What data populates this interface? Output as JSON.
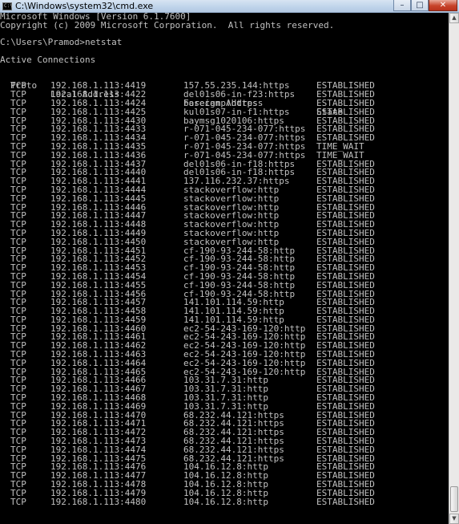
{
  "window": {
    "title": "C:\\Windows\\system32\\cmd.exe",
    "icon_label": "C:\\",
    "controls": {
      "minimize": "–",
      "maximize": "□",
      "close": "✕"
    }
  },
  "console": {
    "banner_line1": "Microsoft Windows [Version 6.1.7600]",
    "banner_line2": "Copyright (c) 2009 Microsoft Corporation.  All rights reserved.",
    "prompt": "C:\\Users\\Pramod>netstat",
    "section_title": "Active Connections",
    "headers": {
      "proto": "Proto",
      "local": "Local Address",
      "foreign": "Foreign Address",
      "state": "State"
    },
    "rows": [
      {
        "proto": "TCP",
        "local": "192.168.1.113:4419",
        "foreign": "157.55.235.144:https",
        "state": "ESTABLISHED"
      },
      {
        "proto": "TCP",
        "local": "192.168.1.113:4422",
        "foreign": "del01s06-in-f23:https",
        "state": "ESTABLISHED"
      },
      {
        "proto": "TCP",
        "local": "192.168.1.113:4424",
        "foreign": "basecamp:https",
        "state": "ESTABLISHED"
      },
      {
        "proto": "TCP",
        "local": "192.168.1.113:4425",
        "foreign": "kul01s07-in-f1:https",
        "state": "ESTABLISHED"
      },
      {
        "proto": "TCP",
        "local": "192.168.1.113:4430",
        "foreign": "baymsg1020106:https",
        "state": "ESTABLISHED"
      },
      {
        "proto": "TCP",
        "local": "192.168.1.113:4433",
        "foreign": "r-071-045-234-077:https",
        "state": "ESTABLISHED"
      },
      {
        "proto": "TCP",
        "local": "192.168.1.113:4434",
        "foreign": "r-071-045-234-077:https",
        "state": "ESTABLISHED"
      },
      {
        "proto": "TCP",
        "local": "192.168.1.113:4435",
        "foreign": "r-071-045-234-077:https",
        "state": "TIME_WAIT"
      },
      {
        "proto": "TCP",
        "local": "192.168.1.113:4436",
        "foreign": "r-071-045-234-077:https",
        "state": "TIME_WAIT"
      },
      {
        "proto": "TCP",
        "local": "192.168.1.113:4437",
        "foreign": "del01s06-in-f18:https",
        "state": "ESTABLISHED"
      },
      {
        "proto": "TCP",
        "local": "192.168.1.113:4440",
        "foreign": "del01s06-in-f18:https",
        "state": "ESTABLISHED"
      },
      {
        "proto": "TCP",
        "local": "192.168.1.113:4441",
        "foreign": "137.116.232.37:https",
        "state": "ESTABLISHED"
      },
      {
        "proto": "TCP",
        "local": "192.168.1.113:4444",
        "foreign": "stackoverflow:http",
        "state": "ESTABLISHED"
      },
      {
        "proto": "TCP",
        "local": "192.168.1.113:4445",
        "foreign": "stackoverflow:http",
        "state": "ESTABLISHED"
      },
      {
        "proto": "TCP",
        "local": "192.168.1.113:4446",
        "foreign": "stackoverflow:http",
        "state": "ESTABLISHED"
      },
      {
        "proto": "TCP",
        "local": "192.168.1.113:4447",
        "foreign": "stackoverflow:http",
        "state": "ESTABLISHED"
      },
      {
        "proto": "TCP",
        "local": "192.168.1.113:4448",
        "foreign": "stackoverflow:http",
        "state": "ESTABLISHED"
      },
      {
        "proto": "TCP",
        "local": "192.168.1.113:4449",
        "foreign": "stackoverflow:http",
        "state": "ESTABLISHED"
      },
      {
        "proto": "TCP",
        "local": "192.168.1.113:4450",
        "foreign": "stackoverflow:http",
        "state": "ESTABLISHED"
      },
      {
        "proto": "TCP",
        "local": "192.168.1.113:4451",
        "foreign": "cf-190-93-244-58:http",
        "state": "ESTABLISHED"
      },
      {
        "proto": "TCP",
        "local": "192.168.1.113:4452",
        "foreign": "cf-190-93-244-58:http",
        "state": "ESTABLISHED"
      },
      {
        "proto": "TCP",
        "local": "192.168.1.113:4453",
        "foreign": "cf-190-93-244-58:http",
        "state": "ESTABLISHED"
      },
      {
        "proto": "TCP",
        "local": "192.168.1.113:4454",
        "foreign": "cf-190-93-244-58:http",
        "state": "ESTABLISHED"
      },
      {
        "proto": "TCP",
        "local": "192.168.1.113:4455",
        "foreign": "cf-190-93-244-58:http",
        "state": "ESTABLISHED"
      },
      {
        "proto": "TCP",
        "local": "192.168.1.113:4456",
        "foreign": "cf-190-93-244-58:http",
        "state": "ESTABLISHED"
      },
      {
        "proto": "TCP",
        "local": "192.168.1.113:4457",
        "foreign": "141.101.114.59:http",
        "state": "ESTABLISHED"
      },
      {
        "proto": "TCP",
        "local": "192.168.1.113:4458",
        "foreign": "141.101.114.59:http",
        "state": "ESTABLISHED"
      },
      {
        "proto": "TCP",
        "local": "192.168.1.113:4459",
        "foreign": "141.101.114.59:http",
        "state": "ESTABLISHED"
      },
      {
        "proto": "TCP",
        "local": "192.168.1.113:4460",
        "foreign": "ec2-54-243-169-120:http",
        "state": "ESTABLISHED"
      },
      {
        "proto": "TCP",
        "local": "192.168.1.113:4461",
        "foreign": "ec2-54-243-169-120:http",
        "state": "ESTABLISHED"
      },
      {
        "proto": "TCP",
        "local": "192.168.1.113:4462",
        "foreign": "ec2-54-243-169-120:http",
        "state": "ESTABLISHED"
      },
      {
        "proto": "TCP",
        "local": "192.168.1.113:4463",
        "foreign": "ec2-54-243-169-120:http",
        "state": "ESTABLISHED"
      },
      {
        "proto": "TCP",
        "local": "192.168.1.113:4464",
        "foreign": "ec2-54-243-169-120:http",
        "state": "ESTABLISHED"
      },
      {
        "proto": "TCP",
        "local": "192.168.1.113:4465",
        "foreign": "ec2-54-243-169-120:http",
        "state": "ESTABLISHED"
      },
      {
        "proto": "TCP",
        "local": "192.168.1.113:4466",
        "foreign": "103.31.7.31:http",
        "state": "ESTABLISHED"
      },
      {
        "proto": "TCP",
        "local": "192.168.1.113:4467",
        "foreign": "103.31.7.31:http",
        "state": "ESTABLISHED"
      },
      {
        "proto": "TCP",
        "local": "192.168.1.113:4468",
        "foreign": "103.31.7.31:http",
        "state": "ESTABLISHED"
      },
      {
        "proto": "TCP",
        "local": "192.168.1.113:4469",
        "foreign": "103.31.7.31:http",
        "state": "ESTABLISHED"
      },
      {
        "proto": "TCP",
        "local": "192.168.1.113:4470",
        "foreign": "68.232.44.121:https",
        "state": "ESTABLISHED"
      },
      {
        "proto": "TCP",
        "local": "192.168.1.113:4471",
        "foreign": "68.232.44.121:https",
        "state": "ESTABLISHED"
      },
      {
        "proto": "TCP",
        "local": "192.168.1.113:4472",
        "foreign": "68.232.44.121:https",
        "state": "ESTABLISHED"
      },
      {
        "proto": "TCP",
        "local": "192.168.1.113:4473",
        "foreign": "68.232.44.121:https",
        "state": "ESTABLISHED"
      },
      {
        "proto": "TCP",
        "local": "192.168.1.113:4474",
        "foreign": "68.232.44.121:https",
        "state": "ESTABLISHED"
      },
      {
        "proto": "TCP",
        "local": "192.168.1.113:4475",
        "foreign": "68.232.44.121:https",
        "state": "ESTABLISHED"
      },
      {
        "proto": "TCP",
        "local": "192.168.1.113:4476",
        "foreign": "104.16.12.8:http",
        "state": "ESTABLISHED"
      },
      {
        "proto": "TCP",
        "local": "192.168.1.113:4477",
        "foreign": "104.16.12.8:http",
        "state": "ESTABLISHED"
      },
      {
        "proto": "TCP",
        "local": "192.168.1.113:4478",
        "foreign": "104.16.12.8:http",
        "state": "ESTABLISHED"
      },
      {
        "proto": "TCP",
        "local": "192.168.1.113:4479",
        "foreign": "104.16.12.8:http",
        "state": "ESTABLISHED"
      },
      {
        "proto": "TCP",
        "local": "192.168.1.113:4480",
        "foreign": "104.16.12.8:http",
        "state": "ESTABLISHED"
      }
    ]
  },
  "colors": {
    "console_background": "#000000",
    "console_text": "#c0c0c0",
    "titlebar": "#bed3ea",
    "close_button": "#c7432a"
  }
}
